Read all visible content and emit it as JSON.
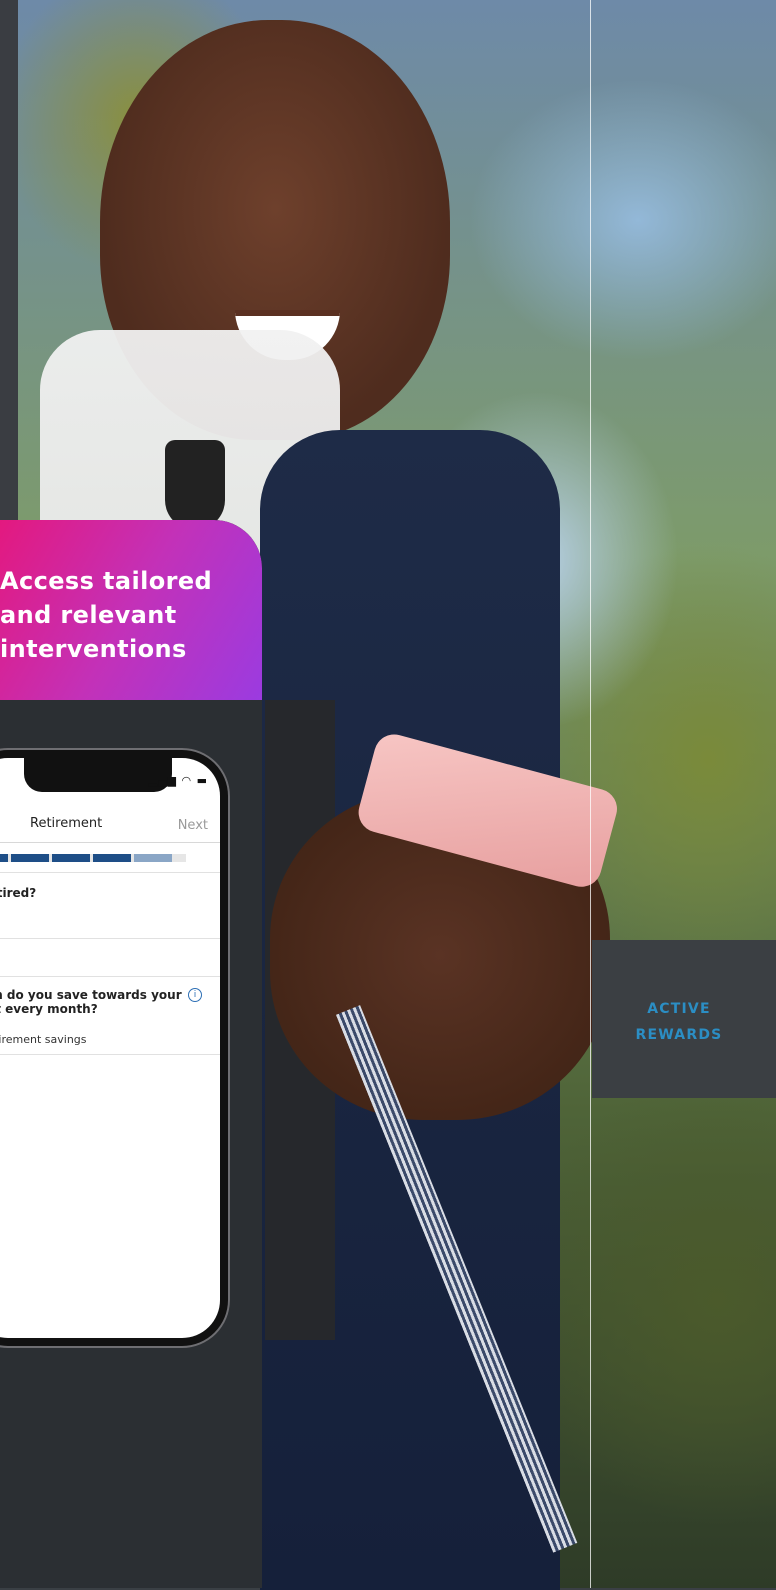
{
  "banner": {
    "lines": [
      "Access tailored",
      "and relevant",
      "interventions"
    ]
  },
  "phone": {
    "nav_title": "Retirement",
    "nav_next": "Next",
    "question_1": "u retired?",
    "question_2_line1": "nuch do you save towards your",
    "question_2_line2": "nent every month?",
    "question_2_sub": "ly retirement savings",
    "info_icon": "info-icon",
    "progress_fraction": 0.75
  },
  "rewards_tab": {
    "lines": [
      "ACTIVE",
      "REWARDS"
    ],
    "color": "#2b8ec4"
  },
  "colors": {
    "banner_gradient_start": "#e3197f",
    "banner_gradient_end": "#9b3be0",
    "panel": "#2b2f33",
    "progress": "#1e4e87"
  }
}
